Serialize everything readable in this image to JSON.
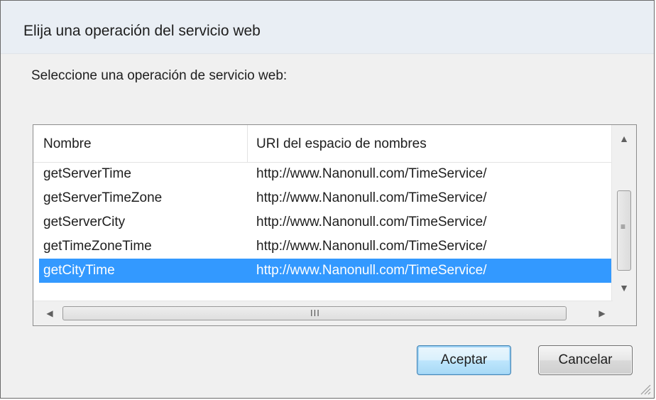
{
  "dialog": {
    "title": "Elija una operación del servicio web",
    "instruction": "Seleccione una operación de servicio web:"
  },
  "list": {
    "columns": [
      "Nombre",
      "URI del espacio de nombres"
    ],
    "rows": [
      {
        "name": "getServerTime",
        "uri": "http://www.Nanonull.com/TimeService/",
        "selected": false
      },
      {
        "name": "getServerTimeZone",
        "uri": "http://www.Nanonull.com/TimeService/",
        "selected": false
      },
      {
        "name": "getServerCity",
        "uri": "http://www.Nanonull.com/TimeService/",
        "selected": false
      },
      {
        "name": "getTimeZoneTime",
        "uri": "http://www.Nanonull.com/TimeService/",
        "selected": false
      },
      {
        "name": "getCityTime",
        "uri": "http://www.Nanonull.com/TimeService/",
        "selected": true
      }
    ]
  },
  "scrollbars": {
    "vertical_grip": "≡",
    "horizontal_grip": "III",
    "icons": [
      "chevron-up-icon",
      "chevron-down-icon",
      "chevron-left-icon",
      "chevron-right-icon"
    ]
  },
  "buttons": {
    "ok_label": "Aceptar",
    "cancel_label": "Cancelar"
  },
  "colors": {
    "selection": "#3399ff",
    "default_button_border": "#3c7fb1"
  }
}
